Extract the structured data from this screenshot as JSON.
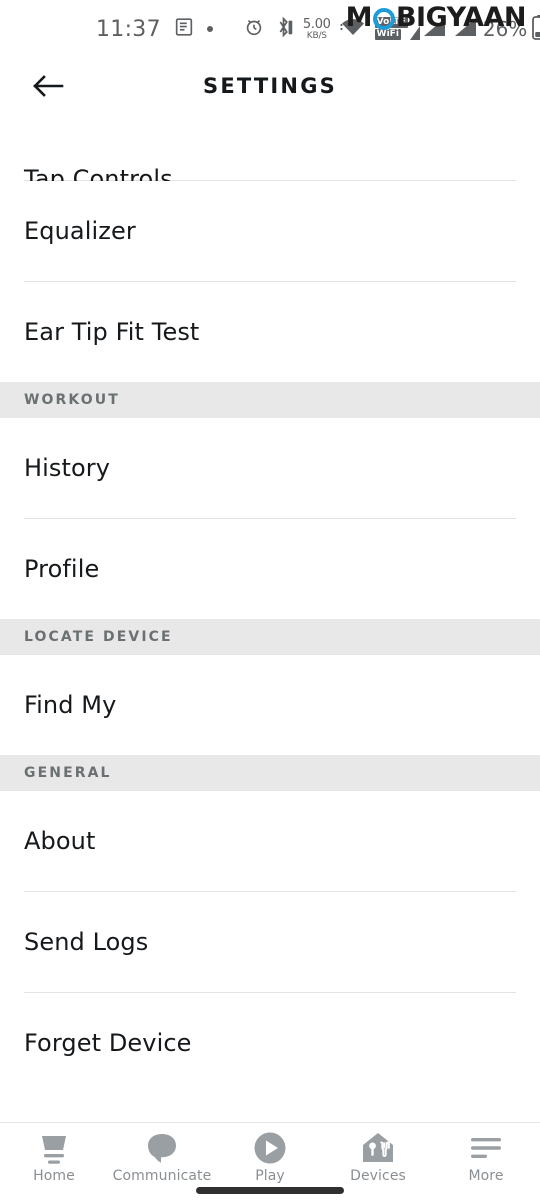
{
  "status_bar": {
    "time": "11:37",
    "network_speed_value": "5.00",
    "network_speed_unit": "KB/S",
    "volte_line1": "VoLTE",
    "volte_line2": "WiFi",
    "battery_percent": "26%",
    "icons": [
      "notes-icon",
      "dot-icon",
      "alarm-icon",
      "bluetooth-icon",
      "wifi-icon",
      "volte-wifi-icon",
      "signal-sim1-icon",
      "signal-sim2-icon",
      "battery-icon"
    ]
  },
  "watermark": {
    "text_before": "M",
    "text_after": "BIGYAAN",
    "accent_color": "#1e9cd7"
  },
  "app_bar": {
    "back_icon": "arrow-left-icon",
    "title": "SETTINGS"
  },
  "list": [
    {
      "type": "row",
      "label": "Tap Controls",
      "clipped": true
    },
    {
      "type": "divider"
    },
    {
      "type": "row",
      "label": "Equalizer",
      "clipped": false
    },
    {
      "type": "divider"
    },
    {
      "type": "row",
      "label": "Ear Tip Fit Test",
      "clipped": false
    },
    {
      "type": "section",
      "label": "WORKOUT"
    },
    {
      "type": "row",
      "label": "History",
      "clipped": false
    },
    {
      "type": "divider"
    },
    {
      "type": "row",
      "label": "Profile",
      "clipped": false
    },
    {
      "type": "section",
      "label": "LOCATE DEVICE"
    },
    {
      "type": "row",
      "label": "Find My",
      "clipped": false
    },
    {
      "type": "section",
      "label": "GENERAL"
    },
    {
      "type": "row",
      "label": "About",
      "clipped": false
    },
    {
      "type": "divider"
    },
    {
      "type": "row",
      "label": "Send Logs",
      "clipped": false
    },
    {
      "type": "divider"
    },
    {
      "type": "row",
      "label": "Forget Device",
      "clipped": false
    }
  ],
  "bottom_nav": {
    "items": [
      {
        "label": "Home",
        "icon": "echo-home-icon"
      },
      {
        "label": "Communicate",
        "icon": "speech-bubble-icon"
      },
      {
        "label": "Play",
        "icon": "play-circle-icon"
      },
      {
        "label": "Devices",
        "icon": "house-devices-icon"
      },
      {
        "label": "More",
        "icon": "hamburger-more-icon"
      }
    ],
    "inactive_color": "#9a9fa3"
  }
}
